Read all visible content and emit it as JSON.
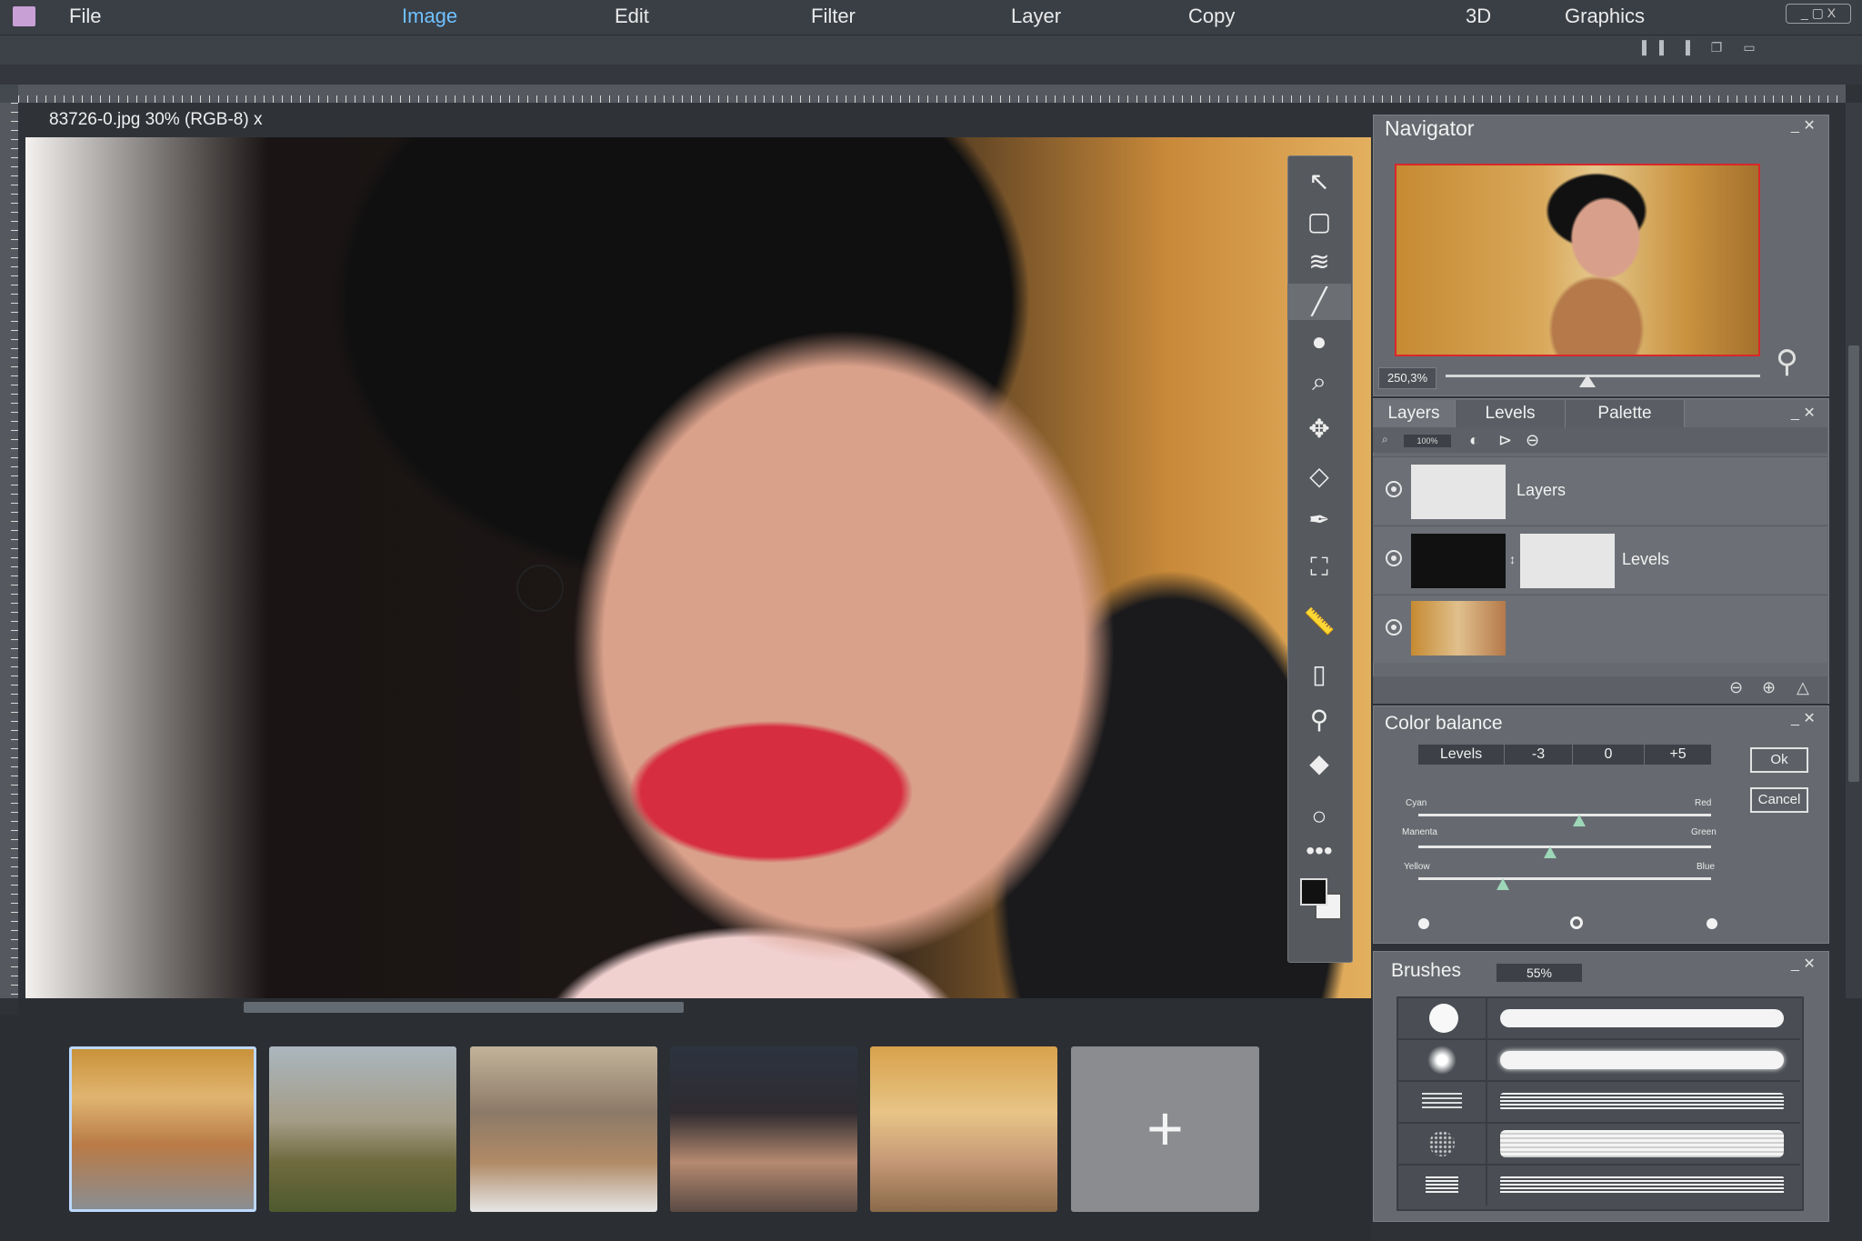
{
  "menu": {
    "items": [
      "File",
      "Image",
      "Edit",
      "Filter",
      "Layer",
      "Copy",
      "3D",
      "Graphics"
    ],
    "active": "Image"
  },
  "window_controls": "_ ▢ X",
  "document": {
    "title": "83726-0.jpg 30% (RGB-8) x"
  },
  "tools": [
    "arrow-icon",
    "rectangle-select-icon",
    "layers-icon",
    "brush-icon",
    "drop-icon",
    "zoom-icon",
    "move-icon",
    "paint-bucket-icon",
    "pen-icon",
    "crop-icon",
    "ruler-icon",
    "page-icon",
    "eyedropper-icon",
    "eraser-icon",
    "ellipse-icon",
    "more-icon"
  ],
  "active_tool": "brush-icon",
  "navigator": {
    "title": "Navigator",
    "zoom": "250,3%",
    "zoom_slider_fraction": 0.45
  },
  "layers_panel": {
    "tabs": [
      "Layers",
      "Levels",
      "Palette"
    ],
    "active_tab": "Layers",
    "opacity": "100%",
    "rows": [
      {
        "name": "Layers"
      },
      {
        "name": "Levels"
      },
      {
        "name": ""
      }
    ]
  },
  "color_balance": {
    "title": "Color balance",
    "levels_label": "Levels",
    "levels": [
      "-3",
      "0",
      "+5"
    ],
    "ok_label": "Ok",
    "cancel_label": "Cancel",
    "sliders": [
      {
        "left": "Cyan",
        "right": "Red",
        "value_fraction": 0.55
      },
      {
        "left": "Manenta",
        "right": "Green",
        "value_fraction": 0.45
      },
      {
        "left": "Yellow",
        "right": "Blue",
        "value_fraction": 0.29
      }
    ],
    "radio_selected_index": 1
  },
  "brushes": {
    "title": "Brushes",
    "size": "55%"
  },
  "filmstrip": {
    "selected_index": 0,
    "add_label": "+"
  },
  "colors": {
    "accent": "#6fc1ff",
    "panel": "#666a70",
    "background": "#2f3338",
    "navigator_frame": "#d8282a"
  }
}
